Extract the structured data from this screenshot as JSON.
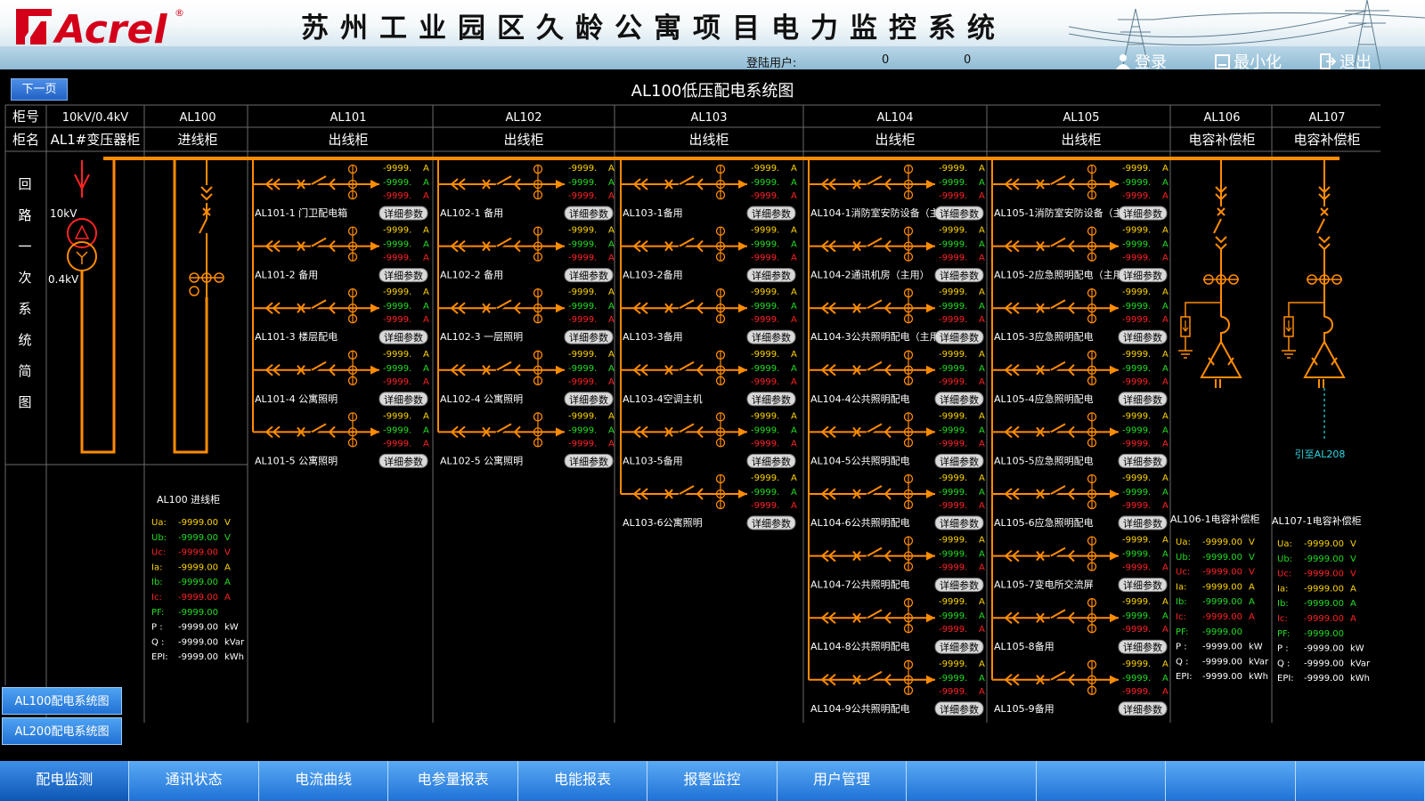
{
  "header": {
    "logo_text": "Acrel",
    "title": "苏州工业园区久龄公寓项目电力监控系统",
    "login_user_label": "登陆用户:",
    "val1": "0",
    "val2": "0",
    "login_btn": "登录",
    "minimize_btn": "最小化",
    "exit_btn": "退出"
  },
  "page": {
    "next_page_btn": "下一页",
    "diagram_title": "AL100低压配电系统图"
  },
  "table_header": {
    "row_label_no": "柜号",
    "row_label_name": "柜名",
    "side_label_chars": [
      "回",
      "路",
      "一",
      "次",
      "系",
      "统",
      "简",
      "图"
    ],
    "cabinets": [
      {
        "no": "10kV/0.4kV",
        "name": "AL1#变压器柜"
      },
      {
        "no": "AL100",
        "name": "进线柜"
      },
      {
        "no": "AL101",
        "name": "出线柜"
      },
      {
        "no": "AL102",
        "name": "出线柜"
      },
      {
        "no": "AL103",
        "name": "出线柜"
      },
      {
        "no": "AL104",
        "name": "出线柜"
      },
      {
        "no": "AL105",
        "name": "出线柜"
      },
      {
        "no": "AL106",
        "name": "电容补偿柜"
      },
      {
        "no": "AL107",
        "name": "电容补偿柜"
      }
    ]
  },
  "transformer": {
    "hv_label": "10kV",
    "lv_label": "0.4kV"
  },
  "feeder_value_text": "-9999.",
  "detail_btn_label": "详细参数",
  "feeder_columns": [
    {
      "id": "AL101",
      "rows": [
        "AL101-1 门卫配电箱",
        "AL101-2 备用",
        "AL101-3 楼层配电",
        "AL101-4 公寓照明",
        "AL101-5 公寓照明"
      ]
    },
    {
      "id": "AL102",
      "rows": [
        "AL102-1 备用",
        "AL102-2 备用",
        "AL102-3 一层照明",
        "AL102-4 公寓照明",
        "AL102-5 公寓照明"
      ]
    },
    {
      "id": "AL103",
      "rows": [
        "AL103-1备用",
        "AL103-2备用",
        "AL103-3备用",
        "AL103-4空调主机",
        "AL103-5备用",
        "AL103-6公寓照明"
      ]
    },
    {
      "id": "AL104",
      "rows": [
        "AL104-1消防室安防设备（主",
        "AL104-2通讯机房（主用）",
        "AL104-3公共照明配电（主用",
        "AL104-4公共照明配电",
        "AL104-5公共照明配电",
        "AL104-6公共照明配电",
        "AL104-7公共照明配电",
        "AL104-8公共照明配电",
        "AL104-9公共照明配电"
      ]
    },
    {
      "id": "AL105",
      "rows": [
        "AL105-1消防室安防设备（主",
        "AL105-2应急照明配电（主用",
        "AL105-3应急照明配电",
        "AL105-4应急照明配电",
        "AL105-5应急照明配电",
        "AL105-6应急照明配电",
        "AL105-7变电所交流屏",
        "AL105-8备用",
        "AL105-9备用"
      ]
    }
  ],
  "measure_rows": [
    {
      "label": "Ua:",
      "value": "-9999.00",
      "unit": "V",
      "color": "#ffd400"
    },
    {
      "label": "Ub:",
      "value": "-9999.00",
      "unit": "V",
      "color": "#22dd22"
    },
    {
      "label": "Uc:",
      "value": "-9999.00",
      "unit": "V",
      "color": "#ff2222"
    },
    {
      "label": "Ia:",
      "value": "-9999.00",
      "unit": "A",
      "color": "#ffd400"
    },
    {
      "label": "Ib:",
      "value": "-9999.00",
      "unit": "A",
      "color": "#22dd22"
    },
    {
      "label": "Ic:",
      "value": "-9999.00",
      "unit": "A",
      "color": "#ff2222"
    },
    {
      "label": "PF:",
      "value": "-9999.00",
      "unit": "",
      "color": "#22dd22"
    },
    {
      "label": "P :",
      "value": "-9999.00",
      "unit": "kW",
      "color": "#ffffff"
    },
    {
      "label": "Q :",
      "value": "-9999.00",
      "unit": "kVar",
      "color": "#ffffff"
    },
    {
      "label": "EPI:",
      "value": "-9999.00",
      "unit": "kWh",
      "color": "#ffffff"
    }
  ],
  "measure_panels": [
    {
      "title": "AL100 进线柜"
    },
    {
      "title": "AL106-1电容补偿柜"
    },
    {
      "title": "AL107-1电容补偿柜"
    }
  ],
  "al107_link_label": "引至AL208",
  "side_buttons": [
    "AL100配电系统图",
    "AL200配电系统图"
  ],
  "nav_tabs": [
    "配电监测",
    "通讯状态",
    "电流曲线",
    "电参量报表",
    "电能报表",
    "报警监控",
    "用户管理",
    "",
    "",
    "",
    ""
  ],
  "colors": {
    "line": "#ff9a1a",
    "bus": "#ff8c00",
    "grid": "#6a6a6a",
    "val_yellow": "#ffd400",
    "val_green": "#22dd22",
    "val_red": "#ff2222",
    "accent_blue": "#2171d4"
  }
}
